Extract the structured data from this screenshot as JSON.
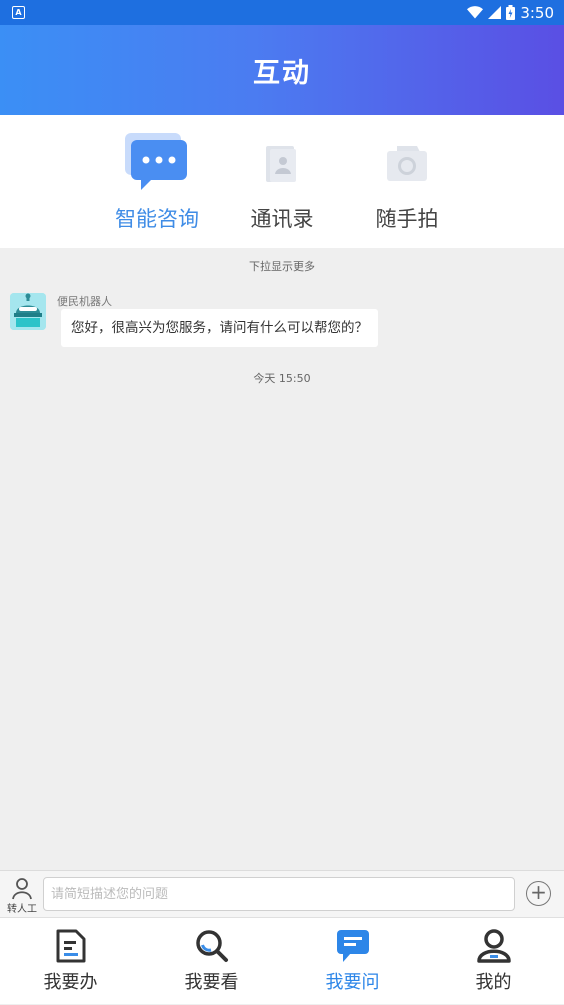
{
  "status_bar": {
    "time": "3:50",
    "app_badge": "A"
  },
  "header": {
    "title": "互动"
  },
  "tabs": [
    {
      "label": "智能咨询",
      "icon": "chat-bubble-icon",
      "active": true
    },
    {
      "label": "通讯录",
      "icon": "contacts-icon",
      "active": false
    },
    {
      "label": "随手拍",
      "icon": "camera-icon",
      "active": false
    }
  ],
  "chat": {
    "pull_hint": "下拉显示更多",
    "messages": [
      {
        "sender": "便民机器人",
        "text": "您好，很高兴为您服务，请问有什么可以帮您的？"
      }
    ],
    "timestamp": "今天 15:50"
  },
  "input_bar": {
    "human_label": "转人工",
    "placeholder": "请简短描述您的问题",
    "value": "",
    "plus": "+"
  },
  "bottom_nav": [
    {
      "label": "我要办",
      "icon": "document-icon",
      "active": false
    },
    {
      "label": "我要看",
      "icon": "search-icon",
      "active": false
    },
    {
      "label": "我要问",
      "icon": "message-icon",
      "active": true
    },
    {
      "label": "我的",
      "icon": "user-icon",
      "active": false
    }
  ],
  "colors": {
    "accent": "#3f8ce6",
    "header_start": "#3b8ff5",
    "header_end": "#5a4fe4",
    "background": "#efefef"
  }
}
